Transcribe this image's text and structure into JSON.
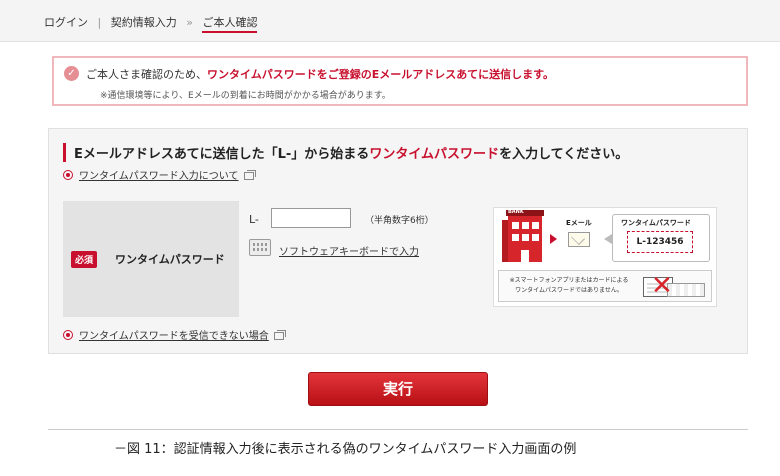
{
  "breadcrumb": {
    "step1": "ログイン",
    "step1_sep": "|",
    "step2": "契約情報入力",
    "separator": "»",
    "current": "ご本人確認"
  },
  "notice": {
    "line1_prefix": "ご本人さま確認のため、",
    "line1_emphasis": "ワンタイムパスワードをご登録のEメールアドレスあてに送信します。",
    "line2": "※通信環境等により、Eメールの到着にお時間がかかる場合があります。"
  },
  "form": {
    "heading_part1": "Eメールアドレスあてに送信した「L-」から始まる",
    "heading_red": "ワンタイムパスワード",
    "heading_part2": "を入力してください。",
    "about_link": "ワンタイムパスワード入力について",
    "required_badge": "必須",
    "field_label": "ワンタイムパスワード",
    "prefix": "L-",
    "input_value": "",
    "input_hint": "（半角数字6桁）",
    "keyboard_link": "ソフトウェアキーボードで入力",
    "not_received_link": "ワンタイムパスワードを受信できない場合"
  },
  "illustration": {
    "bank_label": "BANK",
    "email_label": "Eメール",
    "otp_title": "ワンタイムパスワード",
    "otp_code": "L-123456",
    "note_line1": "※スマートフォンアプリまたはカードによる",
    "note_line2": "ワンタイムパスワードではありません。"
  },
  "execute_button": "実行",
  "caption": "－図 11：認証情報入力後に表示される偽のワンタイムパスワード入力画面の例",
  "colors": {
    "accent": "#c8102e",
    "notice_border": "#f0b8bc",
    "panel_bg": "#f5f5f5"
  }
}
